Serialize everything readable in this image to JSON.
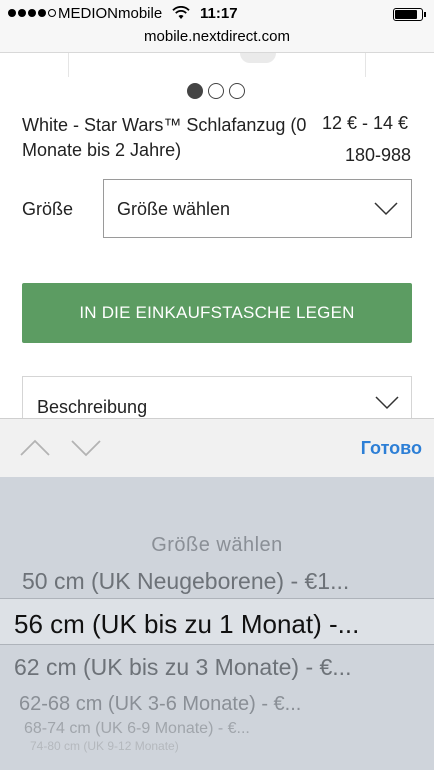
{
  "status_bar": {
    "carrier": "MEDIONmobile",
    "time": "11:17",
    "signal_bars_filled": 4,
    "signal_bars_total": 5,
    "icons": [
      "signal-dots-icon",
      "wifi-icon",
      "battery-icon"
    ]
  },
  "url_bar": {
    "url": "mobile.nextdirect.com"
  },
  "carousel": {
    "pages": 3,
    "active_index": 0
  },
  "product": {
    "name": "White - Star Wars™ Schlafanzug (0 Monate bis 2 Jahre)",
    "price": "12 € - 14 €",
    "item_number": "180-988"
  },
  "size": {
    "label": "Größe",
    "selected": "Größe wählen",
    "icon": "chevron-down-icon"
  },
  "add_button": {
    "label": "IN DIE EINKAUFSTASCHE LEGEN",
    "color": "#5c9c62"
  },
  "description": {
    "label": "Beschreibung",
    "icon": "chevron-down-icon"
  },
  "keyboard_toolbar": {
    "done_label": "Готово",
    "done_color": "#2d7fd6",
    "icons": [
      "chevron-up-icon",
      "chevron-down-icon"
    ]
  },
  "picker": {
    "options": [
      "Größe wählen",
      "50 cm (UK Neugeborene) - €1...",
      "56 cm (UK bis zu 1 Monat) -...",
      "62 cm (UK bis zu 3 Monate) - €...",
      "62-68 cm (UK 3-6 Monate) - €...",
      "68-74 cm (UK 6-9 Monate) - €...",
      "74-80 cm (UK 9-12 Monate)"
    ],
    "selected_index": 2
  }
}
